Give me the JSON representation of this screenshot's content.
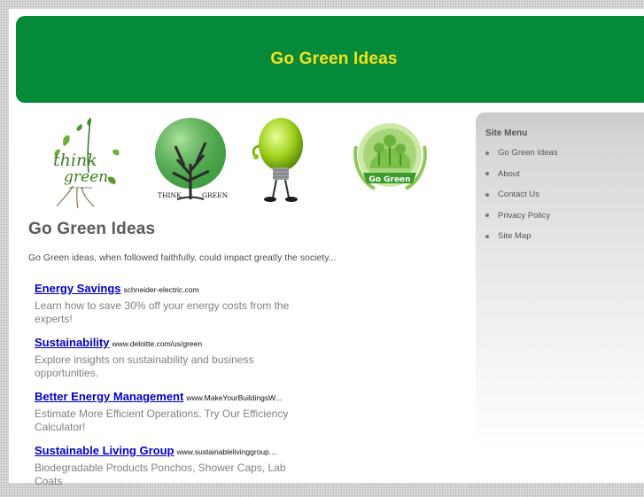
{
  "header": {
    "title": "Go Green Ideas"
  },
  "images": [
    {
      "icon": "think-green-logo",
      "text_main": "think",
      "text_sub": "green",
      "text_small": "with GreenFest"
    },
    {
      "icon": "globe-tree-icon",
      "caption_left": "THINK",
      "caption_right": "GREEN"
    },
    {
      "icon": "lightbulb-mascot-icon"
    },
    {
      "icon": "go-green-badge",
      "badge_text": "Go Green"
    }
  ],
  "main": {
    "heading": "Go Green Ideas",
    "intro": "Go Green ideas, when followed faithfully, could impact greatly the society..."
  },
  "ads": [
    {
      "title": "Energy Savings",
      "url": "schneider-electric.com",
      "desc": "Learn how to save 30% off your energy costs from the experts!"
    },
    {
      "title": "Sustainability",
      "url": "www.deloitte.com/us/green",
      "desc": "Explore insights on sustainability and business opportunities."
    },
    {
      "title": "Better Energy Management",
      "url": "www.MakeYourBuildingsW...",
      "desc": "Estimate More Efficient Operations. Try Our Efficiency Calculator!"
    },
    {
      "title": "Sustainable Living Group",
      "url": "www.sustainablelivinggroup....",
      "desc": "Biodegradable Products Ponchos, Shower Caps, Lab Coats"
    }
  ],
  "sidebar": {
    "title": "Site Menu",
    "items": [
      {
        "label": "Go Green Ideas"
      },
      {
        "label": "About"
      },
      {
        "label": "Contact Us"
      },
      {
        "label": "Privacy Policy"
      },
      {
        "label": "Site Map"
      }
    ]
  },
  "colors": {
    "header_bg": "#058a3a",
    "header_title": "#f7e21a",
    "ad_link": "#0000cc"
  }
}
